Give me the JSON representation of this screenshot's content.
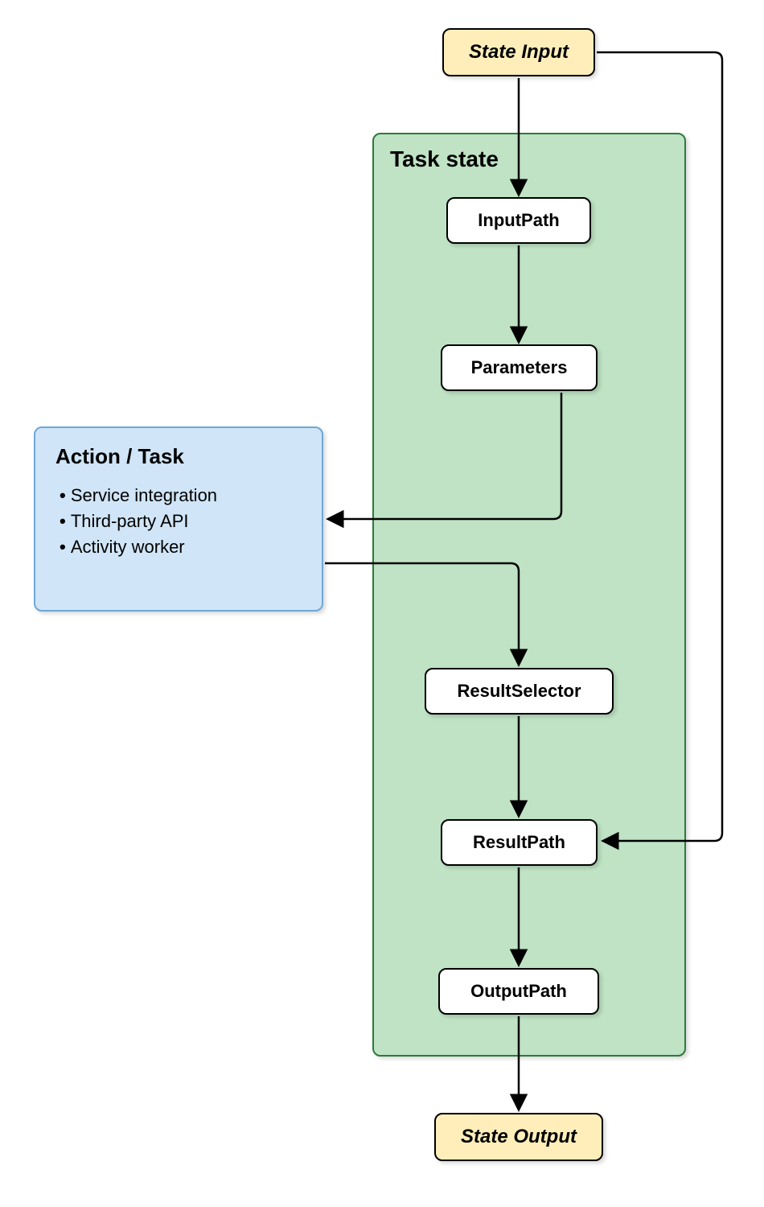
{
  "diagram": {
    "stateInput": "State Input",
    "stateOutput": "State Output",
    "taskStateLabel": "Task state",
    "flowSteps": {
      "inputPath": "InputPath",
      "parameters": "Parameters",
      "resultSelector": "ResultSelector",
      "resultPath": "ResultPath",
      "outputPath": "OutputPath"
    },
    "actionTask": {
      "title": "Action / Task",
      "items": [
        "Service integration",
        "Third-party API",
        "Activity worker"
      ]
    }
  },
  "colors": {
    "stateIoBg": "#ffeeba",
    "taskStateBg": "#bfe3c4",
    "taskStateBorder": "#2d7a3a",
    "actionBg": "#d0e5f7",
    "actionBorder": "#6da8d8",
    "flowBg": "#ffffff"
  }
}
